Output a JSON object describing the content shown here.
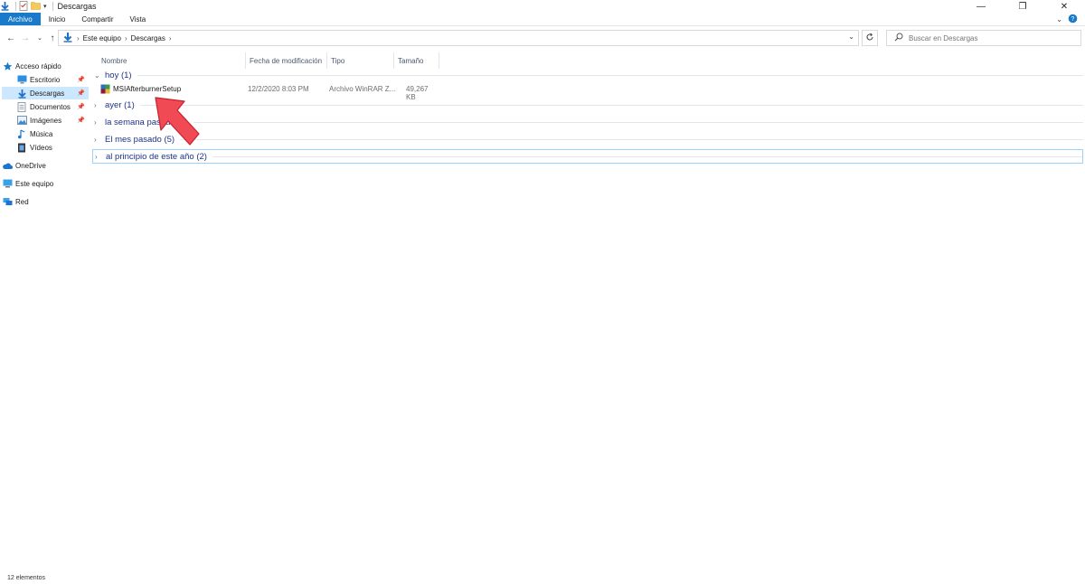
{
  "window": {
    "title": "Descargas"
  },
  "ribbon": {
    "tabs": [
      {
        "label": "Archivo",
        "active": true
      },
      {
        "label": "Inicio",
        "active": false
      },
      {
        "label": "Compartir",
        "active": false
      },
      {
        "label": "Vista",
        "active": false
      }
    ]
  },
  "address": {
    "crumbs": [
      "Este equipo",
      "Descargas"
    ]
  },
  "search": {
    "placeholder": "Buscar en Descargas"
  },
  "nav": {
    "items": [
      {
        "label": "Acceso rápido",
        "icon": "star-icon"
      },
      {
        "label": "Escritorio",
        "icon": "desktop-icon",
        "pinned": true
      },
      {
        "label": "Descargas",
        "icon": "download-icon",
        "pinned": true,
        "selected": true
      },
      {
        "label": "Documentos",
        "icon": "documents-icon",
        "pinned": true
      },
      {
        "label": "Imágenes",
        "icon": "pictures-icon",
        "pinned": true
      },
      {
        "label": "Música",
        "icon": "music-icon"
      },
      {
        "label": "Vídeos",
        "icon": "videos-icon"
      },
      {
        "label": "OneDrive",
        "icon": "cloud-icon"
      },
      {
        "label": "Este equipo",
        "icon": "computer-icon"
      },
      {
        "label": "Red",
        "icon": "network-icon"
      }
    ]
  },
  "columns": [
    "Nombre",
    "Fecha de modificación",
    "Tipo",
    "Tamaño"
  ],
  "groups": [
    {
      "label": "hoy (1)",
      "expanded": true
    },
    {
      "label": "ayer (1)",
      "expanded": false
    },
    {
      "label": "la semana pasada (1)",
      "expanded": false
    },
    {
      "label": "El mes pasado (5)",
      "expanded": false
    },
    {
      "label": "al principio de este año (2)",
      "expanded": false,
      "focused": true
    }
  ],
  "files": [
    {
      "name": "MSIAfterburnerSetup",
      "date": "12/2/2020 8:03 PM",
      "type": "Archivo WinRAR Z...",
      "size": "49,267 KB"
    }
  ],
  "status": {
    "count": "12 elementos"
  },
  "colors": {
    "accent": "#1979ca",
    "selection": "#cce8ff",
    "group_text": "#1e3287",
    "arrow": "#f04a55"
  }
}
